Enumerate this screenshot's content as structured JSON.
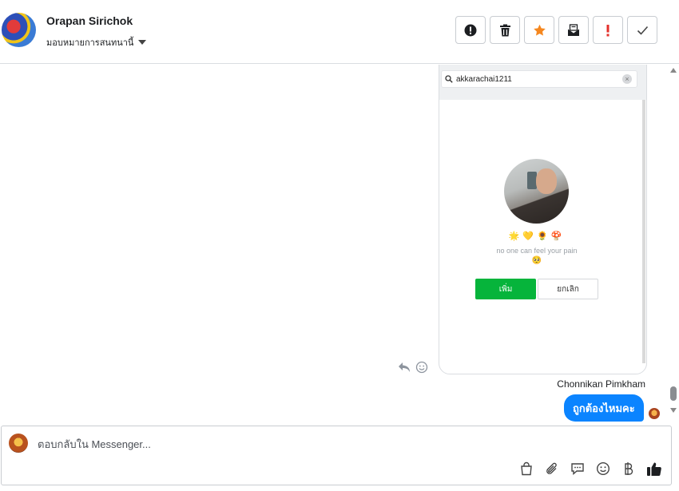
{
  "header": {
    "contact_name": "Orapan Sirichok",
    "assign_label": "มอบหมายการสนทนานี้",
    "actions": [
      {
        "name": "alert-icon"
      },
      {
        "name": "trash-icon"
      },
      {
        "name": "star-icon",
        "color": "#f5871f"
      },
      {
        "name": "mark-unread-icon"
      },
      {
        "name": "important-icon",
        "color": "#e4312b"
      },
      {
        "name": "check-icon"
      }
    ]
  },
  "conversation": {
    "shared_image": {
      "search_text": "akkarachai1211",
      "emojis": "🌟💛🌻🍄",
      "status_text": "no one can feel your pain",
      "status_emoji": "🥺",
      "add_button": "เพิ่ม",
      "cancel_button": "ยกเลิก",
      "add_button_color": "#06b43b"
    },
    "sender_name": "Chonnikan Pimkham",
    "message_text": "ถูกต้องไหมคะ",
    "bubble_color": "#0b84ff"
  },
  "composer": {
    "placeholder": "ตอบกลับใน Messenger...",
    "tools": [
      "shopping-bag-icon",
      "paperclip-icon",
      "chat-icon",
      "emoji-icon",
      "baht-icon",
      "thumbs-up-icon"
    ]
  }
}
